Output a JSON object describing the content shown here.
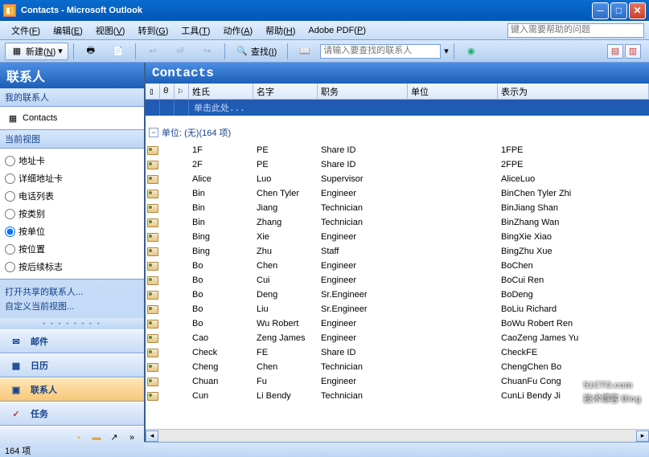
{
  "window": {
    "title": "Contacts - Microsoft Outlook"
  },
  "menubar": {
    "items": [
      {
        "label": "文件",
        "key": "F"
      },
      {
        "label": "编辑",
        "key": "E"
      },
      {
        "label": "视图",
        "key": "V"
      },
      {
        "label": "转到",
        "key": "G"
      },
      {
        "label": "工具",
        "key": "T"
      },
      {
        "label": "动作",
        "key": "A"
      },
      {
        "label": "帮助",
        "key": "H"
      },
      {
        "label": "Adobe PDF",
        "key": "P"
      }
    ],
    "help_placeholder": "键入需要帮助的问题"
  },
  "toolbar": {
    "new_label": "新建",
    "new_key": "N",
    "find_label": "查找",
    "find_key": "I",
    "search_placeholder": "请输入要查找的联系人"
  },
  "navpane": {
    "title": "联系人",
    "my_contacts_label": "我的联系人",
    "contacts_folder": "Contacts",
    "current_view_label": "当前视图",
    "views": [
      {
        "label": "地址卡",
        "selected": false
      },
      {
        "label": "详细地址卡",
        "selected": false
      },
      {
        "label": "电话列表",
        "selected": false
      },
      {
        "label": "按类别",
        "selected": false
      },
      {
        "label": "按单位",
        "selected": true
      },
      {
        "label": "按位置",
        "selected": false
      },
      {
        "label": "按后续标志",
        "selected": false
      }
    ],
    "link_shared": "打开共享的联系人...",
    "link_customize": "自定义当前视图...",
    "buttons": {
      "mail": "邮件",
      "calendar": "日历",
      "contacts": "联系人",
      "tasks": "任务"
    }
  },
  "content": {
    "title": "Contacts",
    "columns": {
      "lastname": "姓氏",
      "firstname": "名字",
      "jobtitle": "职务",
      "company": "单位",
      "displayas": "表示为"
    },
    "new_row_hint": "单击此处...",
    "group_label": "单位: (无)(164 项)",
    "rows": [
      {
        "last": "1F",
        "first": "PE",
        "title": "Share ID",
        "company": "",
        "display": "1FPE"
      },
      {
        "last": "2F",
        "first": "PE",
        "title": "Share ID",
        "company": "",
        "display": "2FPE"
      },
      {
        "last": "Alice",
        "first": "Luo",
        "title": "Supervisor",
        "company": "",
        "display": "AliceLuo"
      },
      {
        "last": "Bin",
        "first": "Chen Tyler",
        "title": "Engineer",
        "company": "",
        "display": "BinChen Tyler Zhi"
      },
      {
        "last": "Bin",
        "first": "Jiang",
        "title": "Technician",
        "company": "",
        "display": "BinJiang Shan"
      },
      {
        "last": "Bin",
        "first": "Zhang",
        "title": "Technician",
        "company": "",
        "display": "BinZhang Wan"
      },
      {
        "last": "Bing",
        "first": "Xie",
        "title": "Engineer",
        "company": "",
        "display": "BingXie Xiao"
      },
      {
        "last": "Bing",
        "first": "Zhu",
        "title": "Staff",
        "company": "",
        "display": "BingZhu Xue"
      },
      {
        "last": "Bo",
        "first": "Chen",
        "title": "Engineer",
        "company": "",
        "display": "BoChen"
      },
      {
        "last": "Bo",
        "first": "Cui",
        "title": "Engineer",
        "company": "",
        "display": "BoCui Ren"
      },
      {
        "last": "Bo",
        "first": "Deng",
        "title": "Sr.Engineer",
        "company": "",
        "display": "BoDeng"
      },
      {
        "last": "Bo",
        "first": "Liu",
        "title": "Sr.Engineer",
        "company": "",
        "display": "BoLiu Richard"
      },
      {
        "last": "Bo",
        "first": "Wu Robert",
        "title": "Engineer",
        "company": "",
        "display": "BoWu Robert Ren"
      },
      {
        "last": "Cao",
        "first": "Zeng James",
        "title": "Engineer",
        "company": "",
        "display": "CaoZeng James Yu"
      },
      {
        "last": "Check",
        "first": "FE",
        "title": "Share ID",
        "company": "",
        "display": "CheckFE"
      },
      {
        "last": "Cheng",
        "first": "Chen",
        "title": "Technician",
        "company": "",
        "display": "ChengChen Bo"
      },
      {
        "last": "Chuan",
        "first": "Fu",
        "title": "Engineer",
        "company": "",
        "display": "ChuanFu Cong"
      },
      {
        "last": "Cun",
        "first": "Li Bendy",
        "title": "Technician",
        "company": "",
        "display": "CunLi Bendy Ji"
      }
    ]
  },
  "statusbar": {
    "text": "164 项"
  },
  "watermark": {
    "main": "51CTO.com",
    "sub": "技术博客 Blog"
  }
}
